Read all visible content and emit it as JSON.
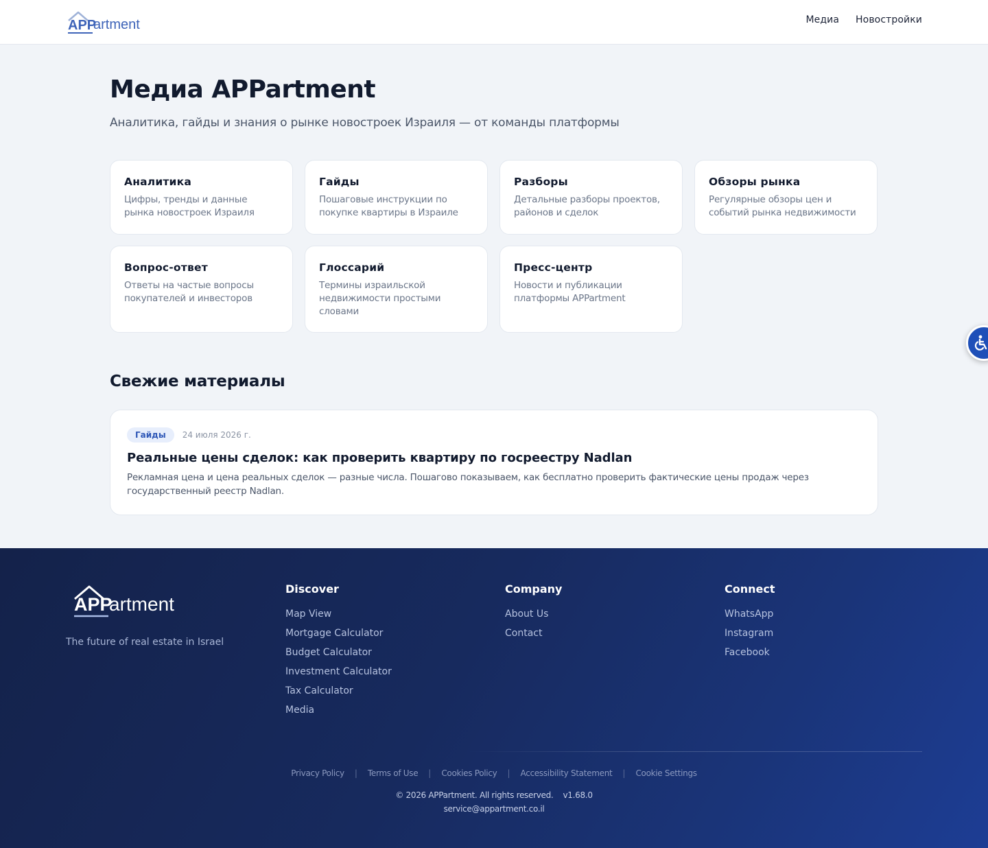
{
  "header": {
    "logo_app": "APP",
    "logo_rest": "artment",
    "nav": [
      "Медиа",
      "Новостройки"
    ]
  },
  "hero": {
    "title": "Медиа APPartment",
    "subtitle": "Аналитика, гайды и знания о рынке новостроек Израиля — от команды платформы"
  },
  "categories": [
    {
      "title": "Аналитика",
      "desc": "Цифры, тренды и данные рынка новостроек Израиля"
    },
    {
      "title": "Гайды",
      "desc": "Пошаговые инструкции по покупке квартиры в Израиле"
    },
    {
      "title": "Разборы",
      "desc": "Детальные разборы проектов, районов и сделок"
    },
    {
      "title": "Обзоры рынка",
      "desc": "Регулярные обзоры цен и событий рынка недвижимости"
    },
    {
      "title": "Вопрос-ответ",
      "desc": "Ответы на частые вопросы покупателей и инвесторов"
    },
    {
      "title": "Глоссарий",
      "desc": "Термины израильской недвижимости простыми словами"
    },
    {
      "title": "Пресс-центр",
      "desc": "Новости и публикации платформы APPartment"
    }
  ],
  "fresh": {
    "section_title": "Свежие материалы",
    "article": {
      "badge": "Гайды",
      "date": "24 июля 2026 г.",
      "title": "Реальные цены сделок: как проверить квартиру по госреестру Nadlan",
      "excerpt": "Рекламная цена и цена реальных сделок — разные числа. Пошагово показываем, как бесплатно проверить фактические цены продаж через государственный реестр Nadlan."
    }
  },
  "footer": {
    "logo_app": "APP",
    "logo_rest": "artment",
    "tagline": "The future of real estate in Israel",
    "columns": [
      {
        "title": "Discover",
        "links": [
          "Map View",
          "Mortgage Calculator",
          "Budget Calculator",
          "Investment Calculator",
          "Tax Calculator",
          "Media"
        ]
      },
      {
        "title": "Company",
        "links": [
          "About Us",
          "Contact"
        ]
      },
      {
        "title": "Connect",
        "links": [
          "WhatsApp",
          "Instagram",
          "Facebook"
        ]
      }
    ],
    "legal": [
      "Privacy Policy",
      "Terms of Use",
      "Cookies Policy",
      "Accessibility Statement",
      "Cookie Settings"
    ],
    "copyright": "© 2026 APPartment. All rights reserved.    v1.68.0",
    "email": "service@appartment.co.il"
  },
  "colors": {
    "brand_blue": "#2f58b7",
    "logo_blue": "#3d63b8",
    "footer_dark": "#14224a",
    "footer_light": "#1d3d94"
  },
  "icons": {
    "accessibility": "accessibility-wheelchair-icon"
  }
}
